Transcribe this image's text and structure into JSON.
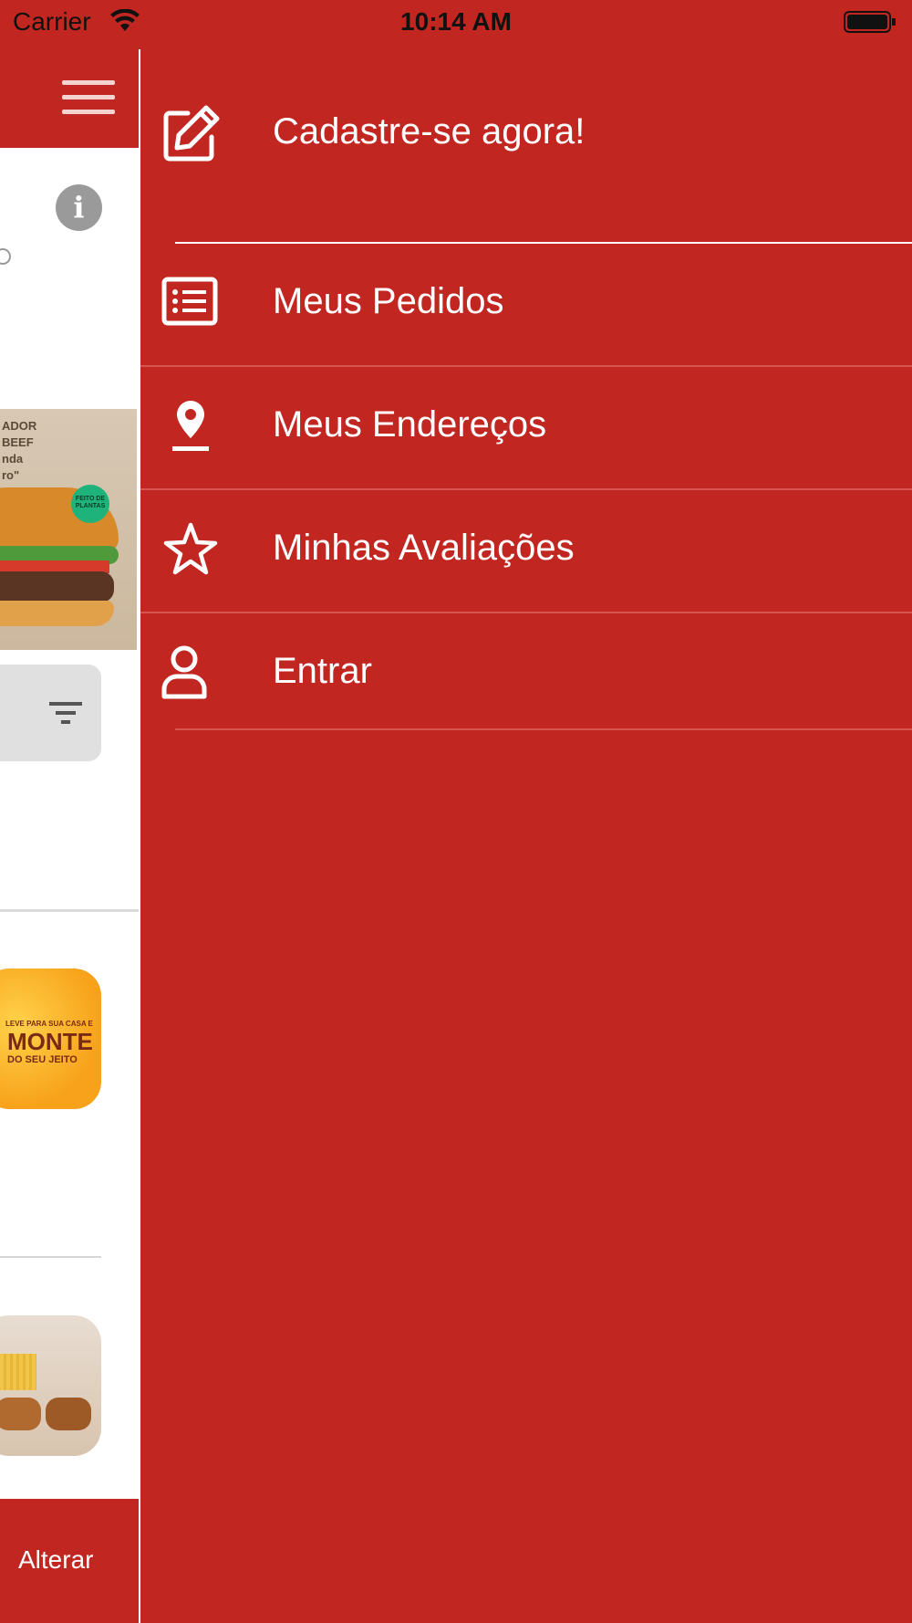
{
  "status_bar": {
    "carrier": "Carrier",
    "time": "10:14 AM",
    "wifi_icon": "wifi-icon",
    "battery_icon": "battery-icon"
  },
  "background_screen": {
    "menu_icon": "hamburger-menu-icon",
    "info_icon": "info-icon",
    "info_glyph": "i",
    "banner": {
      "text_lines": [
        "ADOR",
        "BEEF",
        "nda",
        "ro\""
      ],
      "badge_text": "FEITO DE PLANTAS"
    },
    "filter_icon": "filter-icon",
    "promo": {
      "small_text": "LEVE PARA SUA CASA E",
      "big_text": "MONTE",
      "sub_text": "DO SEU JEITO"
    },
    "footer_button": "Alterar"
  },
  "drawer": {
    "items": [
      {
        "label": "Cadastre-se agora!",
        "icon": "edit-icon"
      },
      {
        "label": "Meus Pedidos",
        "icon": "list-icon"
      },
      {
        "label": "Meus Endereços",
        "icon": "location-pin-icon"
      },
      {
        "label": "Minhas Avaliações",
        "icon": "star-icon"
      },
      {
        "label": "Entrar",
        "icon": "user-icon"
      }
    ]
  },
  "colors": {
    "brand_red": "#c22621",
    "white": "#ffffff",
    "separator": "#d75550"
  }
}
